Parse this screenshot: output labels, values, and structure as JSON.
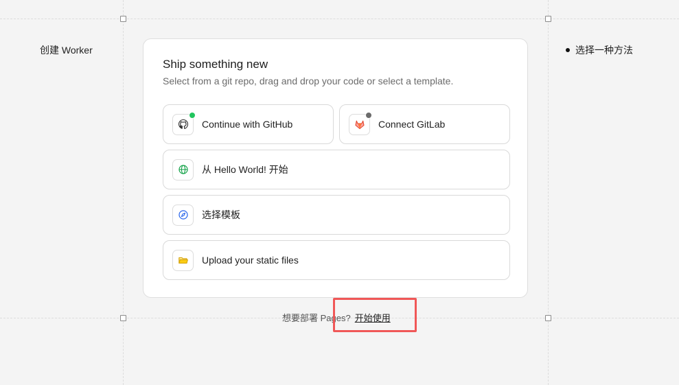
{
  "left": {
    "title": "创建 Worker"
  },
  "right": {
    "step": "选择一种方法"
  },
  "card": {
    "title": "Ship something new",
    "subtitle": "Select from a git repo, drag and drop your code or select a template."
  },
  "options": {
    "github": {
      "label": "Continue with GitHub",
      "icon": "github-icon",
      "status_color": "#22c55e"
    },
    "gitlab": {
      "label": "Connect GitLab",
      "icon": "gitlab-icon",
      "status_color": "#6b6b6b"
    },
    "hello_world": {
      "label": "从 Hello World! 开始",
      "icon": "globe-icon"
    },
    "template": {
      "label": "选择模板",
      "icon": "compass-icon"
    },
    "upload": {
      "label": "Upload your static files",
      "icon": "folder-icon"
    }
  },
  "footer": {
    "question": "想要部署 Pages?",
    "link": "开始使用"
  },
  "colors": {
    "highlight": "#f05757",
    "globe": "#16a34a",
    "compass": "#2563eb",
    "folder": "#eab308",
    "gitlab": "#e24329"
  }
}
